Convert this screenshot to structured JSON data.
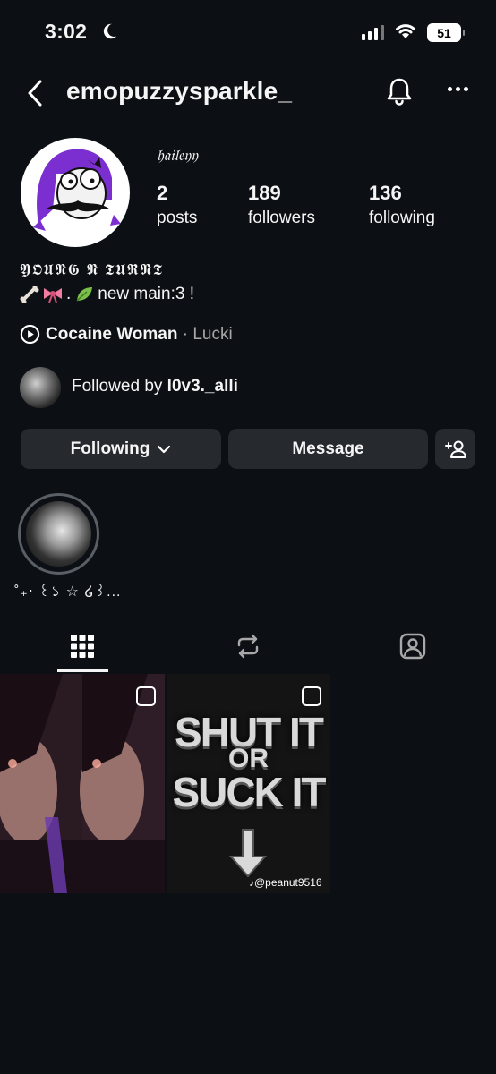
{
  "status_bar": {
    "time": "3:02",
    "battery": "51"
  },
  "header": {
    "username": "emopuzzysparkle_"
  },
  "profile": {
    "display_name": "𝔥𝔞𝔦𝔩𝔢𝔶𝔶",
    "stats": [
      {
        "value": "2",
        "label": "posts"
      },
      {
        "value": "189",
        "label": "followers"
      },
      {
        "value": "136",
        "label": "following"
      }
    ],
    "bio_line1": "𝖄𝕺𝖀𝕹𝕲 𝕹 𝕿𝖀𝕽𝕹𝕿",
    "bio_line2_text": "new main:3 !",
    "music": {
      "song": "Cocaine Woman",
      "separator": " · ",
      "artist": "Lucki"
    },
    "followed_by_prefix": "Followed by ",
    "followed_by_user": "l0v3._alli"
  },
  "actions": {
    "following_label": "Following",
    "message_label": "Message"
  },
  "highlights": [
    {
      "label": "˚₊‧ ꒰১ ☆ ໒꒱..."
    }
  ],
  "posts": [
    {
      "type": "image"
    },
    {
      "type": "image",
      "line1": "SHUT IT",
      "line2": "OR",
      "line3": "SUCK IT",
      "watermark": "@peanut9516"
    }
  ],
  "colors": {
    "background": "#0c1014",
    "button": "#262a2f",
    "secondary_text": "#a8a8a8",
    "avatar_purple": "#7b2fd0"
  }
}
